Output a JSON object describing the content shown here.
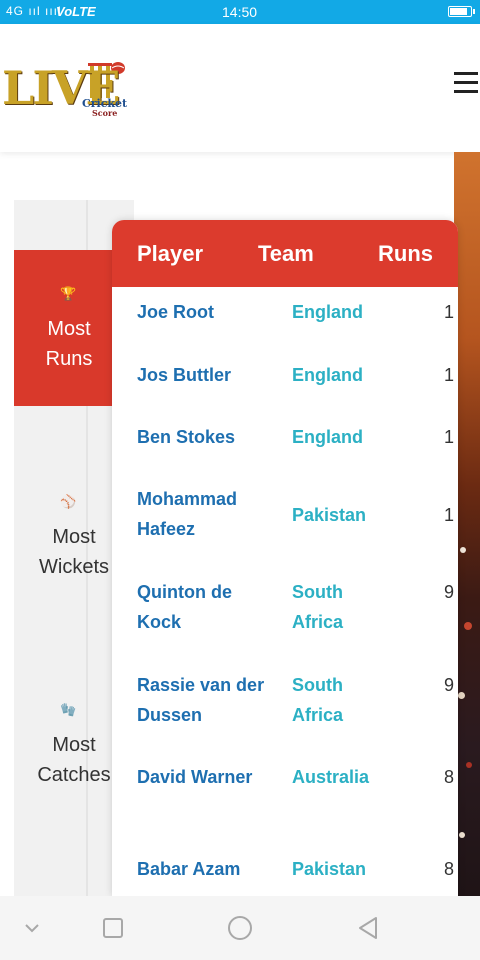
{
  "status_bar": {
    "signal": "4G ııl ıııl",
    "network": "VoLTE",
    "time": "14:50",
    "battery_level": 0.9
  },
  "header": {
    "logo_main": "LIVE",
    "logo_sub1": "Cricket",
    "logo_sub2": "Score",
    "menu_icon": "hamburger-icon"
  },
  "categories": [
    {
      "icon": "trophy-icon",
      "glyph": "🏆",
      "line1": "Most",
      "line2": "Runs",
      "active": true
    },
    {
      "icon": "ball-icon",
      "glyph": "⚾",
      "line1": "Most",
      "line2": "Wickets",
      "active": false
    },
    {
      "icon": "glove-icon",
      "glyph": "🧤",
      "line1": "Most",
      "line2": "Catches",
      "active": false
    }
  ],
  "table": {
    "headers": {
      "player": "Player",
      "team": "Team",
      "runs": "Runs"
    },
    "rows": [
      {
        "player": "Joe Root",
        "team": "England",
        "runs": "1"
      },
      {
        "player": "Jos Buttler",
        "team": "England",
        "runs": "1"
      },
      {
        "player": "Ben Stokes",
        "team": "England",
        "runs": "1"
      },
      {
        "player": "Mohammad Hafeez",
        "team": "Pakistan",
        "runs": "1"
      },
      {
        "player": "Quinton de Kock",
        "team": "South Africa",
        "runs": "9"
      },
      {
        "player": "Rassie van der Dussen",
        "team": "South Africa",
        "runs": "9"
      },
      {
        "player": "David Warner",
        "team": "Australia",
        "runs": "8"
      },
      {
        "player": "Babar Azam",
        "team": "Pakistan",
        "runs": "8"
      }
    ]
  },
  "navbar": {
    "items": [
      "chevron-down-icon",
      "recents-icon",
      "home-icon",
      "back-icon"
    ]
  },
  "colors": {
    "status_bar": "#12a9e6",
    "header_red": "#dc3b2d",
    "player_blue": "#1e6fb0",
    "team_teal": "#2cb0c4"
  }
}
